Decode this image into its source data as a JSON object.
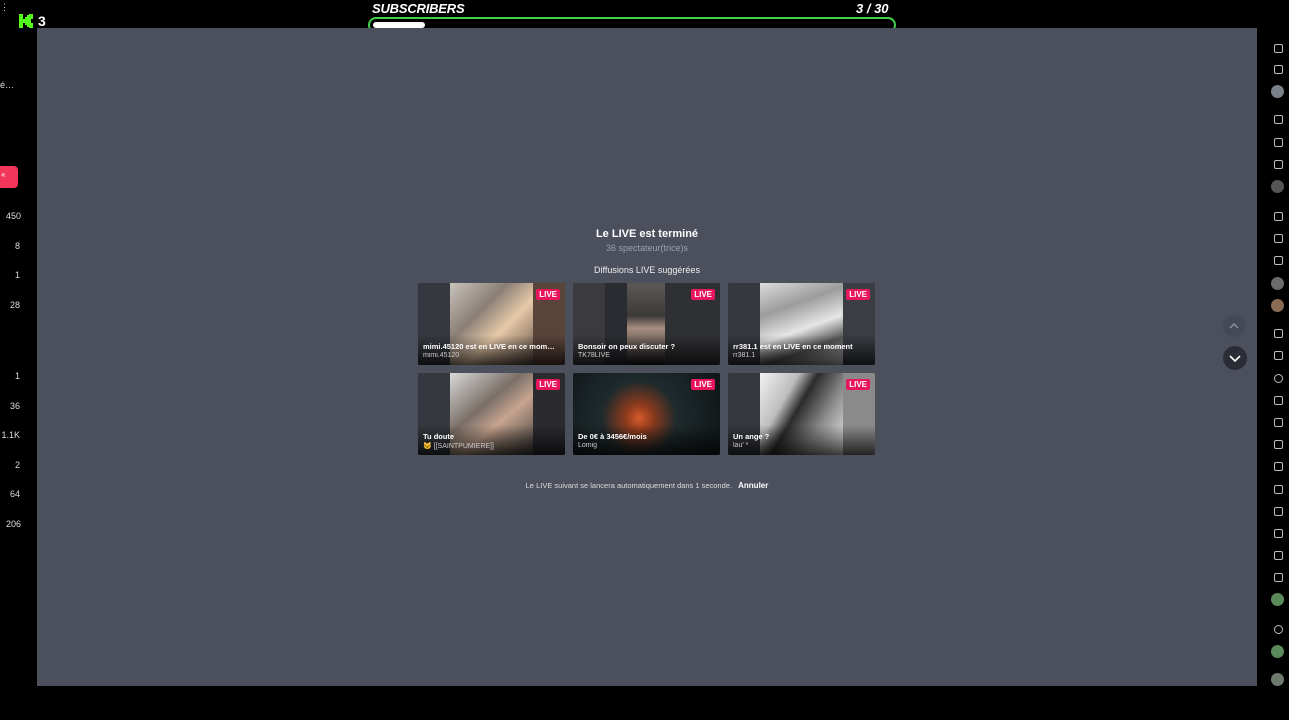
{
  "overlay": {
    "kick_count": "3",
    "subscribers_label": "SUBSCRIBERS",
    "subscribers_count": "3  / 30",
    "subscribers_progress": 0.1,
    "accent": "#3fd04a"
  },
  "left_sidebar": {
    "truncated_text": "é…",
    "counts": [
      "450",
      "8",
      "1",
      "28",
      "1",
      "36",
      "1.1K",
      "2",
      "64",
      "206"
    ]
  },
  "live_end": {
    "title": "Le LIVE est terminé",
    "viewers": "36 spectateur(trice)s",
    "suggested_heading": "Diffusions LIVE suggérées",
    "auto_next_text": "Le LIVE suivant se lancera automatiquement dans 1 seconde.",
    "cancel_label": "Annuler"
  },
  "cards": [
    {
      "badge": "LIVE",
      "title": "mimi.45120 est en LIVE en ce mom…",
      "user": "mimi.45120"
    },
    {
      "badge": "LIVE",
      "title": "Bonsoir on peux discuter ?",
      "user": "TK78LIVE"
    },
    {
      "badge": "LIVE",
      "title": "rr381.1 est en LIVE en ce moment",
      "user": "rr381.1"
    },
    {
      "badge": "LIVE",
      "title": "Tu doute",
      "user": "🐱 [[SAINTPUMIERE]]"
    },
    {
      "badge": "LIVE",
      "title": "De 0€ à 3456€/mois",
      "user": "Lomig"
    },
    {
      "badge": "LIVE",
      "title": "Un ange ?",
      "user": "lau' *"
    }
  ],
  "colors": {
    "background": "#4c505d",
    "live_badge": "#e8175d",
    "sidebar_red": "#f2365a"
  }
}
